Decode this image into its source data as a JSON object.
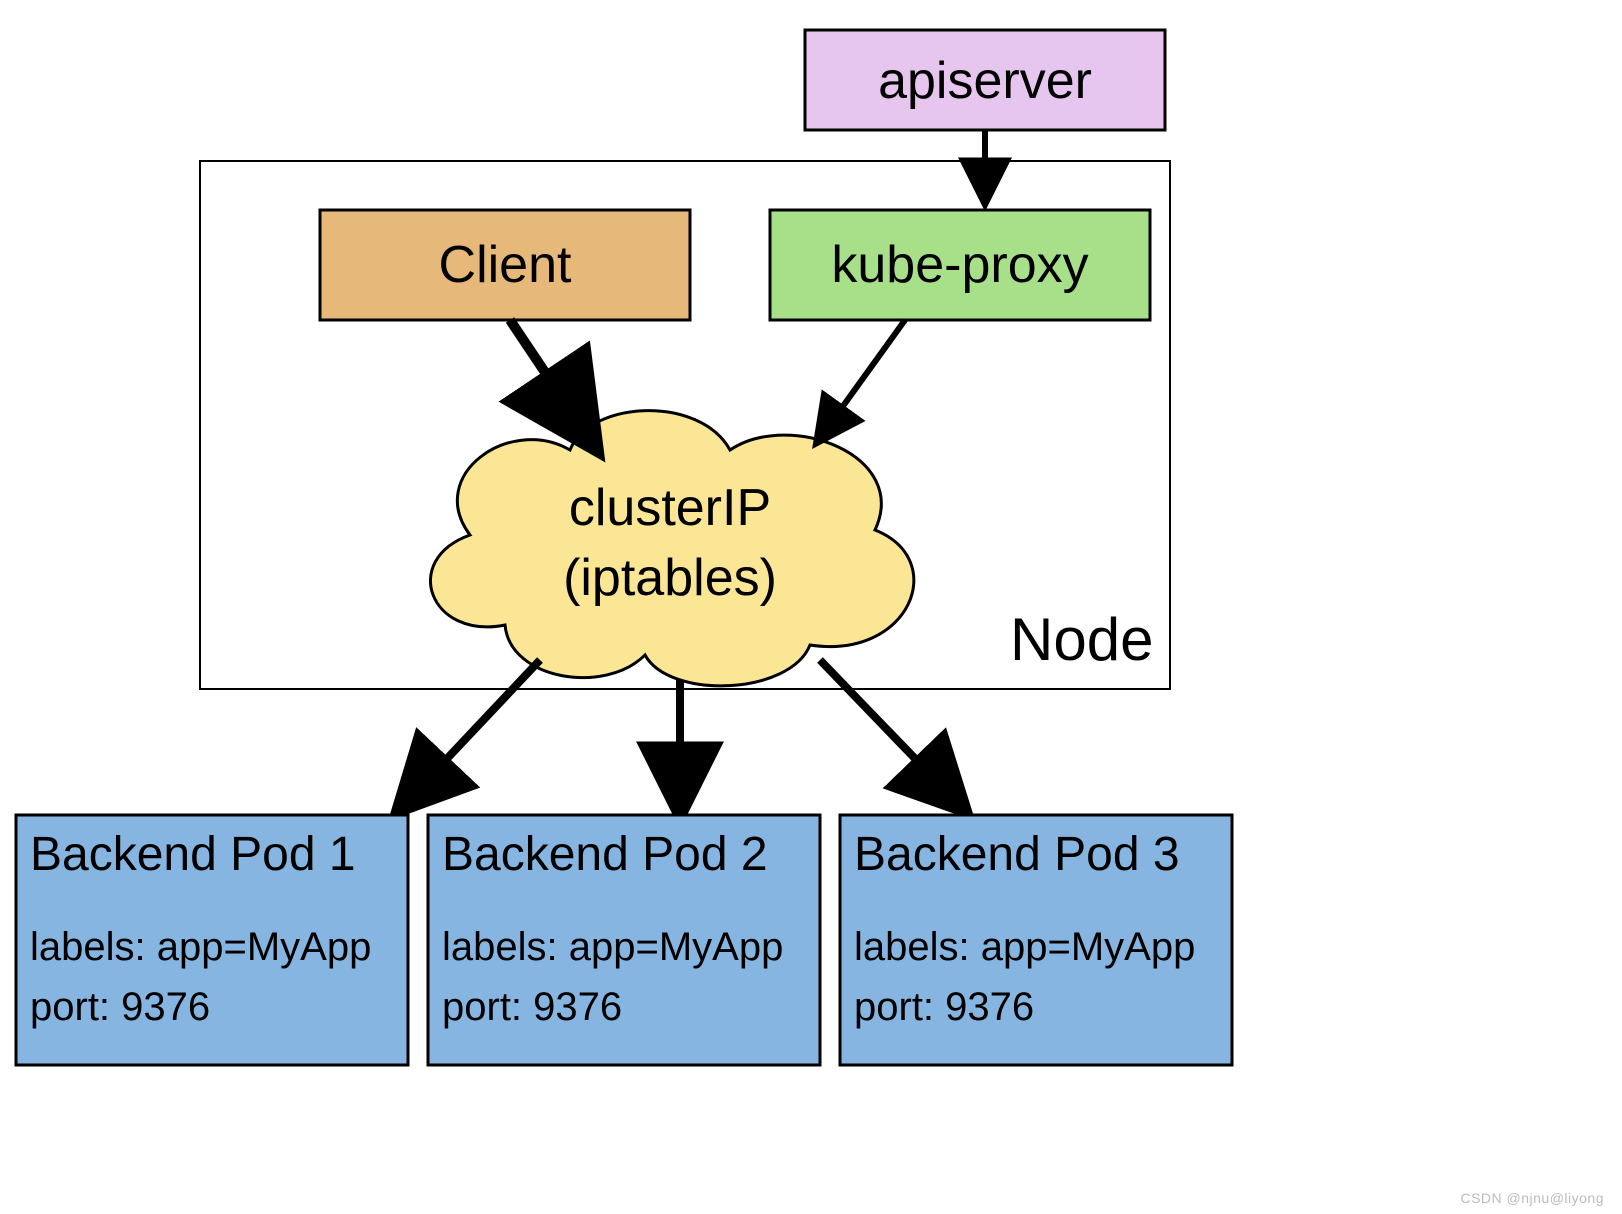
{
  "colors": {
    "apiserver": "#E6C6EF",
    "client": "#E6B87A",
    "kubeproxy": "#A8E08A",
    "cloud": "#FBE695",
    "pod": "#85B5E0",
    "stroke": "#000000"
  },
  "apiserver": {
    "label": "apiserver"
  },
  "node": {
    "label": "Node"
  },
  "client": {
    "label": "Client"
  },
  "kubeproxy": {
    "label": "kube-proxy"
  },
  "clusterip": {
    "line1": "clusterIP",
    "line2": "(iptables)"
  },
  "pods": [
    {
      "title": "Backend Pod 1",
      "labels": "labels: app=MyApp",
      "port": "port: 9376"
    },
    {
      "title": "Backend Pod 2",
      "labels": "labels: app=MyApp",
      "port": "port: 9376"
    },
    {
      "title": "Backend Pod 3",
      "labels": "labels: app=MyApp",
      "port": "port: 9376"
    }
  ],
  "watermark": "CSDN @njnu@liyong"
}
